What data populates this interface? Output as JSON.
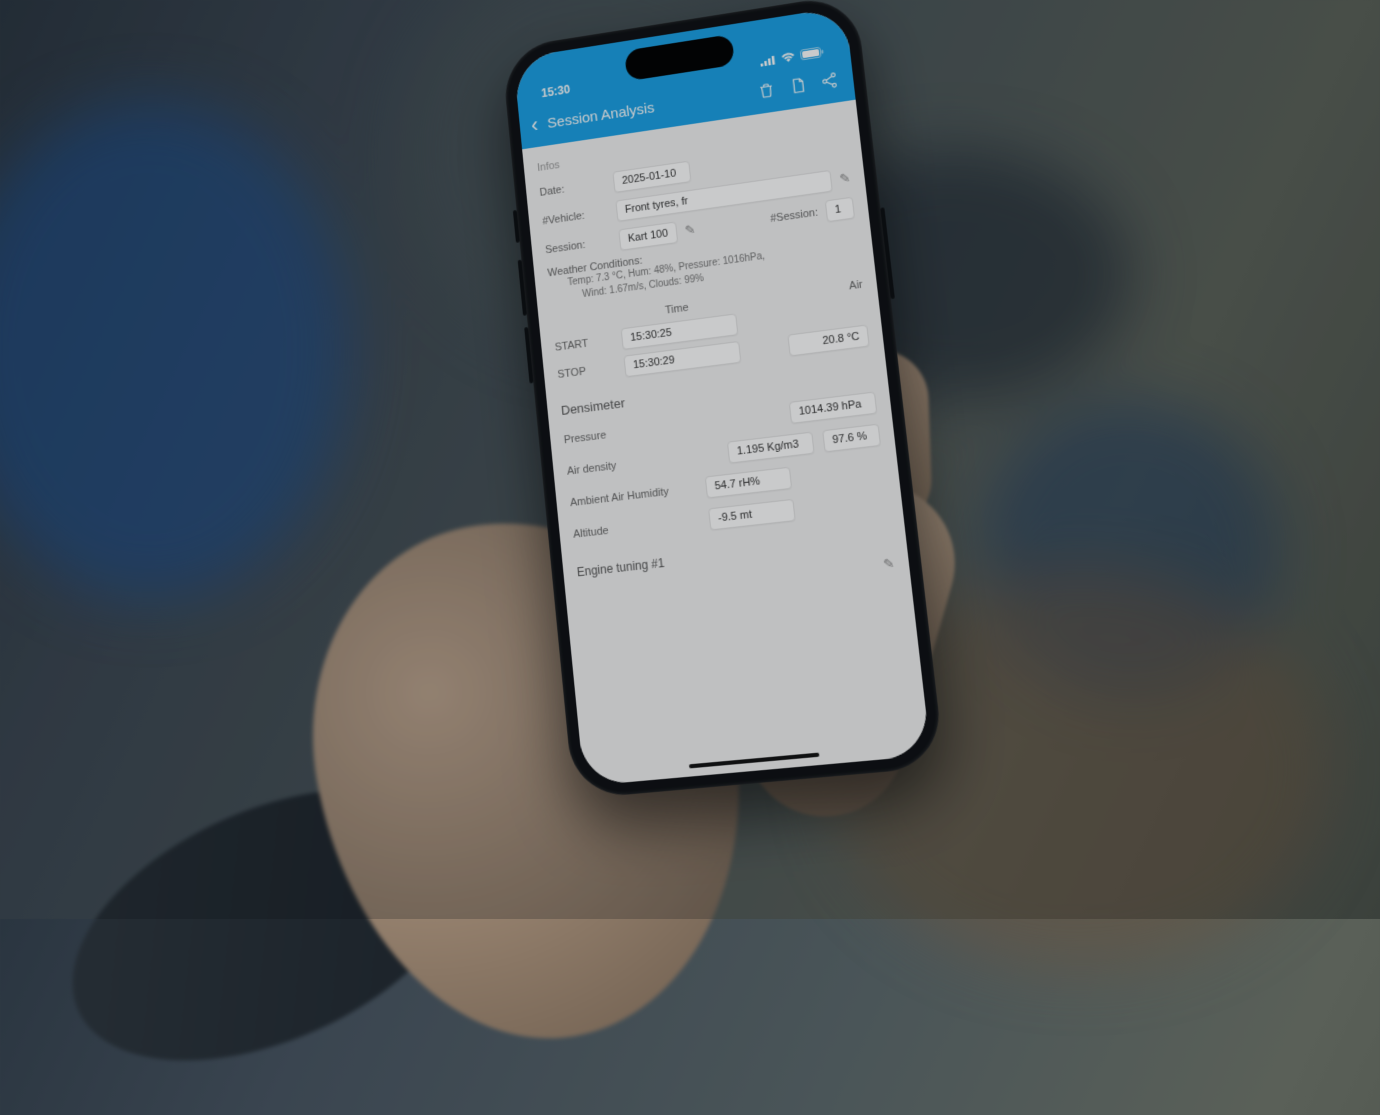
{
  "statusbar": {
    "time": "15:30",
    "carrier": ""
  },
  "header": {
    "back": "‹",
    "title": "Session Analysis"
  },
  "info": {
    "section_label": "Infos",
    "date_label": "Date:",
    "date_value": "2025-01-10",
    "vehicle_label": "#Vehicle:",
    "vehicle_value": "Front tyres, fr",
    "session_label": "Session:",
    "session_value": "Kart 100",
    "session_num_label": "#Session:",
    "session_num_value": "1"
  },
  "weather": {
    "label": "Weather Conditions:",
    "line1": "Temp: 7.3 °C, Hum: 48%, Pressure: 1016hPa,",
    "line2": "Wind: 1.67m/s, Clouds: 99%"
  },
  "timing": {
    "time_header": "Time",
    "air_header": "Air",
    "start_label": "START",
    "start_time": "15:30:25",
    "stop_label": "STOP",
    "stop_time": "15:30:29",
    "air_temp": "20.8 °C"
  },
  "densimeter": {
    "title": "Densimeter",
    "pressure_label": "Pressure",
    "pressure_value": "1014.39 hPa",
    "density_label": "Air density",
    "density_value": "1.195 Kg/m3",
    "density_pct": "97.6 %",
    "humidity_label": "Ambient Air Humidity",
    "humidity_value": "54.7 rH%",
    "altitude_label": "Altitude",
    "altitude_value": "-9.5 mt"
  },
  "engine": {
    "title": "Engine tuning #1"
  }
}
